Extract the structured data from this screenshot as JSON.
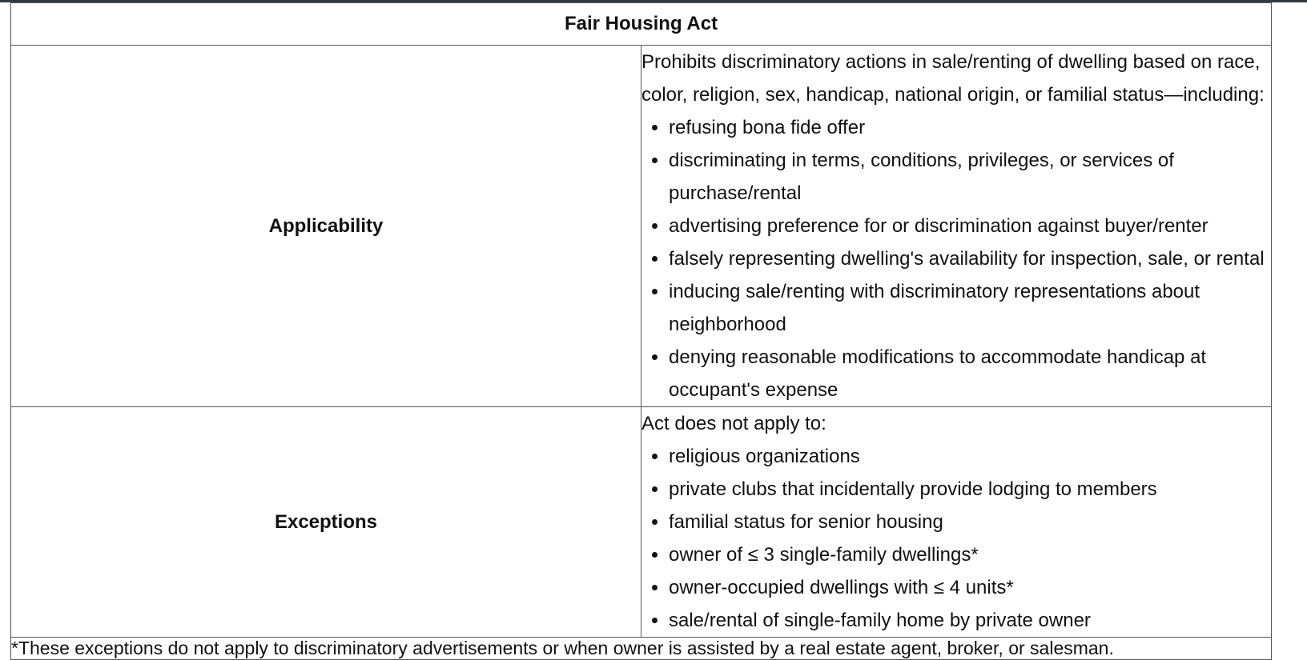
{
  "table": {
    "title": "Fair Housing Act",
    "applicability": {
      "label": "Applicability",
      "intro": "Prohibits discriminatory actions in sale/renting of dwelling based on race, color, religion, sex, handicap, national origin, or familial status—including:",
      "items": [
        "refusing bona fide offer",
        "discriminating in terms, conditions, privileges, or services of purchase/rental",
        "advertising preference for or discrimination against buyer/renter",
        "falsely representing dwelling's availability for inspection, sale, or rental",
        "inducing sale/renting with discriminatory representations about neighborhood",
        "denying reasonable modifications to accommodate handicap at occupant's expense"
      ]
    },
    "exceptions": {
      "label": "Exceptions",
      "intro": "Act does not apply to:",
      "items": [
        "religious organizations",
        "private clubs that incidentally provide lodging to members",
        "familial status for senior housing",
        "owner of ≤ 3 single-family dwellings*",
        "owner-occupied dwellings with ≤ 4 units*",
        "sale/rental of single-family home by private owner"
      ]
    },
    "footnote": "*These exceptions do not apply to discriminatory advertisements or when owner is assisted by a real estate agent, broker, or salesman."
  }
}
